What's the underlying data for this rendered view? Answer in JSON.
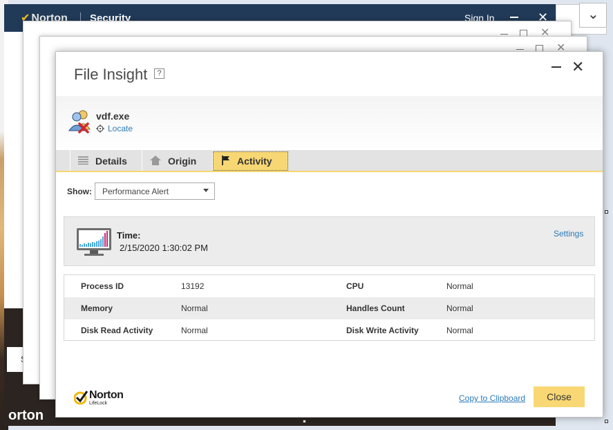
{
  "background": {
    "app_brand": "Norton",
    "app_section": "Security",
    "sign_in": "Sign In",
    "bottom_brand": "orton",
    "partial_letter": "S"
  },
  "dialog": {
    "title": "File Insight",
    "help_glyph": "?",
    "file_name": "vdf.exe",
    "locate_label": "Locate",
    "tabs": [
      {
        "label": "Details",
        "icon": "list-icon",
        "active": false
      },
      {
        "label": "Origin",
        "icon": "home-icon",
        "active": false
      },
      {
        "label": "Activity",
        "icon": "flag-icon",
        "active": true
      }
    ],
    "show_label": "Show:",
    "show_value": "Performance Alert",
    "alert": {
      "time_label": "Time:",
      "time_value": "2/15/2020 1:30:02 PM",
      "settings_label": "Settings"
    },
    "stats": [
      {
        "label1": "Process ID",
        "value1": "13192",
        "label2": "CPU",
        "value2": "Normal"
      },
      {
        "label1": "Memory",
        "value1": "Normal",
        "label2": "Handles Count",
        "value2": "Normal"
      },
      {
        "label1": "Disk Read Activity",
        "value1": "Normal",
        "label2": "Disk Write Activity",
        "value2": "Normal"
      }
    ],
    "logo_brand": "Norton",
    "logo_sub": "LifeLock",
    "copy_label": "Copy to Clipboard",
    "close_label": "Close"
  },
  "colors": {
    "accent_yellow": "#f8d774",
    "link_blue": "#2a7ab8",
    "header_navy": "#213a58"
  }
}
